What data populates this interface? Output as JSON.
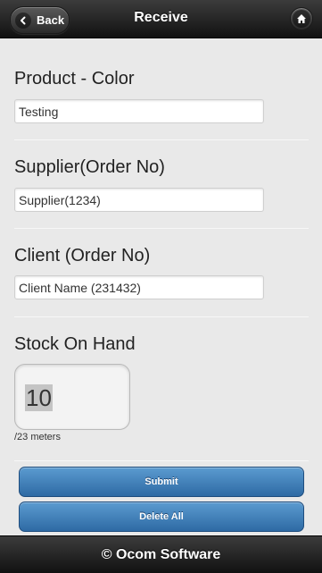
{
  "header": {
    "back_label": "Back",
    "title": "Receive"
  },
  "icons": {
    "back": "chevron-left-icon",
    "home": "home-icon"
  },
  "form": {
    "product": {
      "label": "Product - Color",
      "value": "Testing"
    },
    "supplier": {
      "label": "Supplier(Order No)",
      "value": "Supplier(1234)"
    },
    "client": {
      "label": "Client (Order No)",
      "value": "Client Name (231432)"
    },
    "stock": {
      "label": "Stock On Hand",
      "value": "10",
      "unit": "/23 meters"
    }
  },
  "actions": {
    "submit_label": "Submit",
    "delete_all_label": "Delete All"
  },
  "footer": {
    "text": "© Ocom Software"
  },
  "colors": {
    "bar_dark": "#111111",
    "page_bg": "#e9e9e9",
    "button_blue": "#3a7bbf"
  }
}
